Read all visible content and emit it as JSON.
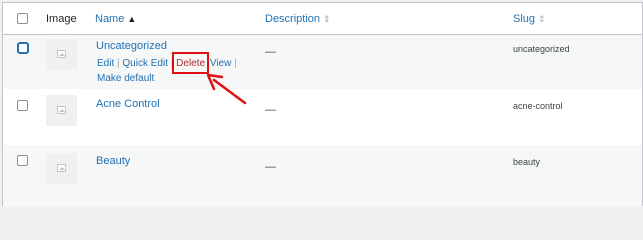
{
  "table": {
    "headers": {
      "image": "Image",
      "name": "Name",
      "description": "Description",
      "slug": "Slug"
    },
    "rows": [
      {
        "name": "Uncategorized",
        "description": "—",
        "slug": "uncategorized",
        "actions": {
          "edit": "Edit",
          "quick_edit": "Quick Edit",
          "delete": "Delete",
          "view": "View",
          "make_default": "Make default",
          "separator": "|"
        }
      },
      {
        "name": "Acne Control",
        "description": "—",
        "slug": "acne-control"
      },
      {
        "name": "Beauty",
        "description": "—",
        "slug": "beauty"
      }
    ]
  },
  "colors": {
    "link": "#2271b1",
    "delete": "#b32d2e",
    "highlight": "#dd1111",
    "row_alt": "#f6f7f7"
  },
  "icons": {
    "sort_active": "caret-up-icon",
    "sort_inactive": "sort-icon",
    "placeholder": "image-placeholder-icon"
  }
}
